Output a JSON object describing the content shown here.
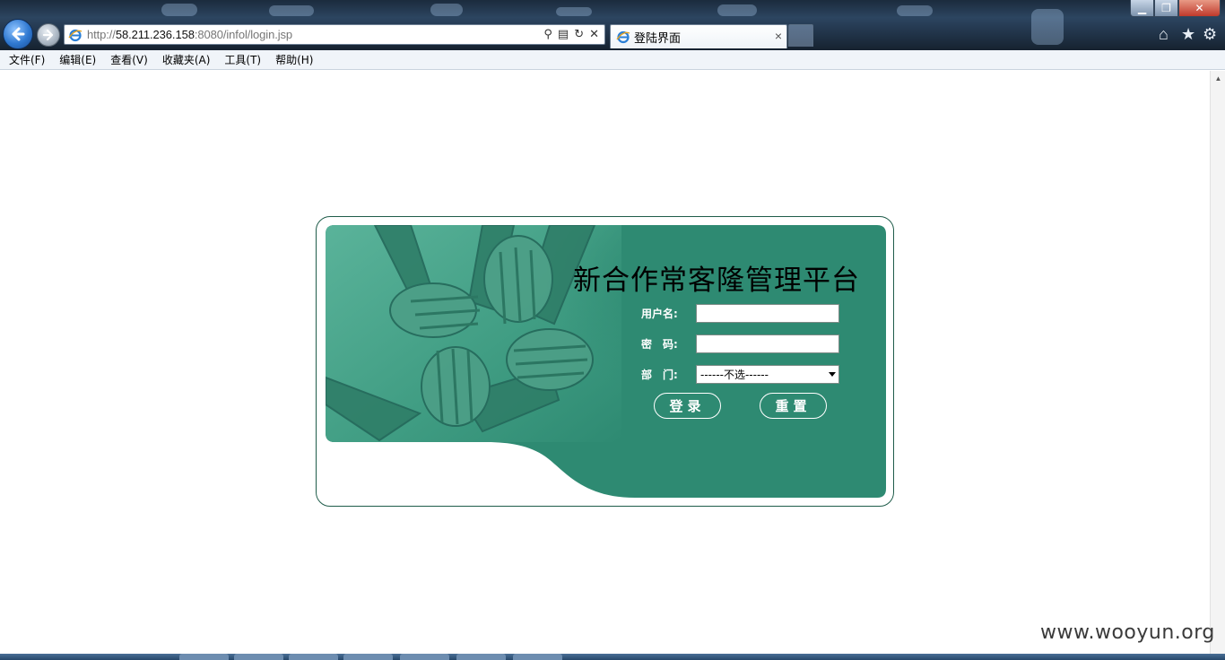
{
  "browser": {
    "url_prefix": "http://",
    "url_host": "58.211.236.158",
    "url_rest": ":8080/infol/login.jsp",
    "tab_title": "登陆界面",
    "tab_close": "×",
    "window_min": "▁",
    "window_max": "❐",
    "window_close": "✕"
  },
  "menu": [
    "文件(F)",
    "编辑(E)",
    "查看(V)",
    "收藏夹(A)",
    "工具(T)",
    "帮助(H)"
  ],
  "icons": {
    "back": "back-arrow-icon",
    "forward": "forward-arrow-icon",
    "home": "home-icon",
    "favorites": "star-icon",
    "tools": "gear-icon"
  },
  "login": {
    "title": "新合作常客隆管理平台",
    "username_label": "用户名:",
    "password_label": "密　码:",
    "department_label": "部　门:",
    "department_selected": "------不选------",
    "login_button": "登录",
    "reset_button": "重置"
  },
  "colors": {
    "panel_green": "#2e8a72",
    "border_green": "#1f5c4a"
  },
  "watermark": "www.wooyun.org"
}
